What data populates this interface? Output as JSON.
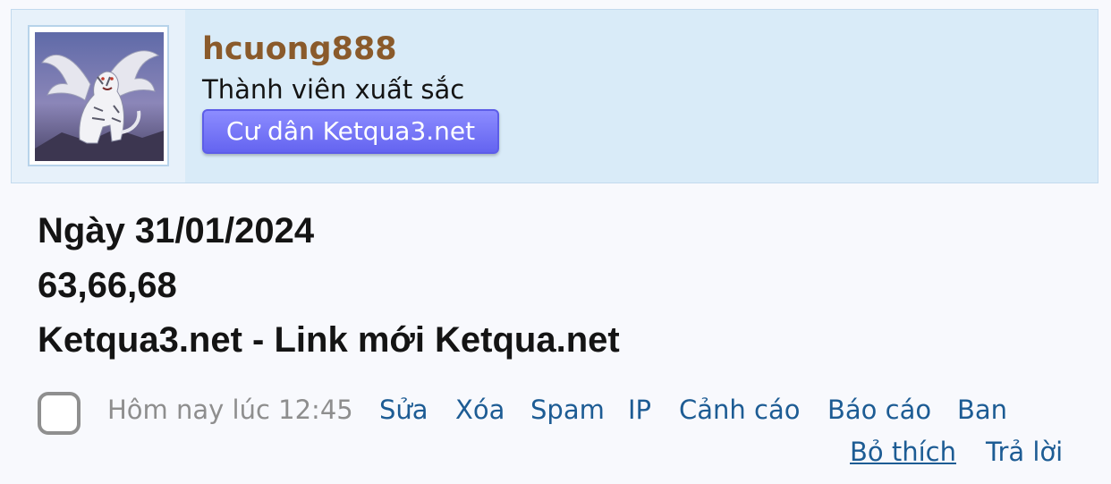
{
  "user": {
    "username": "hcuong888",
    "title": "Thành viên xuất sắc",
    "banner": "Cư dân Ketqua3.net"
  },
  "message": {
    "lines": [
      "Ngày 31/01/2024",
      "63,66,68",
      "Ketqua3.net - Link mới Ketqua.net"
    ]
  },
  "footer": {
    "date": "Hôm nay lúc 12:45",
    "controls": {
      "edit": "Sửa",
      "delete": "Xóa",
      "spam": "Spam",
      "ip": "IP",
      "warn": "Cảnh cáo",
      "report": "Báo cáo",
      "ban": "Ban",
      "unlike": "Bỏ thích",
      "reply": "Trả lời"
    }
  },
  "colors": {
    "header_bg": "#d9ebf8",
    "username": "#8a5a2b",
    "banner": "#6c6cf5",
    "link": "#1d5c94",
    "meta": "#8e8e8e"
  },
  "icons": {
    "avatar": "white-tiger-with-wings-avatar",
    "select": "checkbox-icon"
  }
}
